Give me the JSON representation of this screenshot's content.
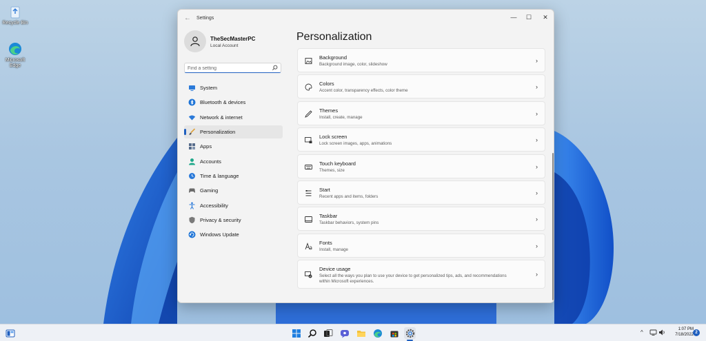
{
  "desktop": {
    "icons": [
      {
        "label": "Recycle Bin",
        "icon": "recycle-bin-icon"
      },
      {
        "label": "Microsoft Edge",
        "icon": "edge-icon"
      }
    ]
  },
  "window": {
    "title": "Settings",
    "back_glyph": "←",
    "controls": {
      "minimize": "—",
      "maximize": "☐",
      "close": "✕"
    }
  },
  "profile": {
    "name": "TheSecMasterPC",
    "account_type": "Local Account"
  },
  "search": {
    "placeholder": "Find a setting"
  },
  "nav": {
    "items": [
      {
        "label": "System",
        "icon": "display-icon",
        "selected": false
      },
      {
        "label": "Bluetooth & devices",
        "icon": "bluetooth-icon",
        "selected": false
      },
      {
        "label": "Network & internet",
        "icon": "wifi-icon",
        "selected": false
      },
      {
        "label": "Personalization",
        "icon": "brush-icon",
        "selected": true
      },
      {
        "label": "Apps",
        "icon": "apps-icon",
        "selected": false
      },
      {
        "label": "Accounts",
        "icon": "person-icon",
        "selected": false
      },
      {
        "label": "Time & language",
        "icon": "globe-clock-icon",
        "selected": false
      },
      {
        "label": "Gaming",
        "icon": "gamepad-icon",
        "selected": false
      },
      {
        "label": "Accessibility",
        "icon": "accessibility-icon",
        "selected": false
      },
      {
        "label": "Privacy & security",
        "icon": "shield-icon",
        "selected": false
      },
      {
        "label": "Windows Update",
        "icon": "update-icon",
        "selected": false
      }
    ]
  },
  "content": {
    "title": "Personalization",
    "cards": [
      {
        "title": "Background",
        "subtitle": "Background image, color, slideshow",
        "icon": "image-icon"
      },
      {
        "title": "Colors",
        "subtitle": "Accent color, transparency effects, color theme",
        "icon": "palette-icon"
      },
      {
        "title": "Themes",
        "subtitle": "Install, create, manage",
        "icon": "pen-icon"
      },
      {
        "title": "Lock screen",
        "subtitle": "Lock screen images, apps, animations",
        "icon": "lock-screen-icon"
      },
      {
        "title": "Touch keyboard",
        "subtitle": "Themes, size",
        "icon": "keyboard-icon"
      },
      {
        "title": "Start",
        "subtitle": "Recent apps and items, folders",
        "icon": "start-grid-icon"
      },
      {
        "title": "Taskbar",
        "subtitle": "Taskbar behaviors, system pins",
        "icon": "taskbar-icon"
      },
      {
        "title": "Fonts",
        "subtitle": "Install, manage",
        "icon": "fonts-icon"
      },
      {
        "title": "Device usage",
        "subtitle": "Select all the ways you plan to use your device to get personalized tips, ads, and recommendations within Microsoft experiences.",
        "icon": "device-usage-icon"
      }
    ]
  },
  "taskbar": {
    "icons": [
      "widgets-icon",
      "windows-start-icon",
      "search-icon",
      "task-view-icon",
      "chat-icon",
      "file-explorer-icon",
      "edge-icon",
      "store-icon",
      "settings-gear-icon"
    ],
    "tray": {
      "chevron": "^",
      "time": "1:07 PM",
      "date": "7/18/2022",
      "notifications": "2"
    }
  },
  "colors": {
    "accent": "#1f5fbf",
    "window_bg": "#f3f3f3",
    "card_bg": "#fbfbfb"
  }
}
